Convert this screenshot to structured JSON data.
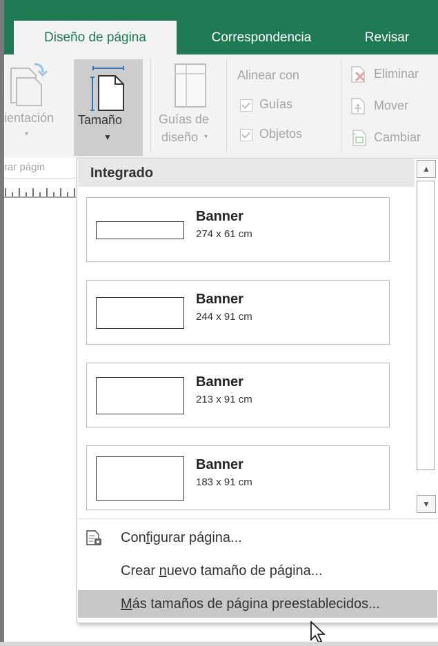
{
  "tabs": [
    {
      "label": "Diseño de página",
      "active": true
    },
    {
      "label": "Correspondencia",
      "active": false
    },
    {
      "label": "Revisar",
      "active": false
    }
  ],
  "ribbon": {
    "orientation_label": "ientación",
    "size_label": "Tamaño",
    "guides_line1": "Guías de",
    "guides_line2": "diseño",
    "align_title": "Alinear con",
    "align_guides": "Guías",
    "align_objects": "Objetos",
    "delete_label": "Eliminar",
    "move_label": "Mover",
    "change_label": "Cambiar",
    "group_label": "rar págin"
  },
  "dropdown": {
    "header": "Integrado",
    "items": [
      {
        "name": "Banner",
        "size": "274 x 61 cm"
      },
      {
        "name": "Banner",
        "size": "244 x 91 cm"
      },
      {
        "name": "Banner",
        "size": "213 x 91 cm"
      },
      {
        "name": "Banner",
        "size": "183 x 91 cm"
      }
    ],
    "menu": {
      "setup_pre": "Con",
      "setup_u": "f",
      "setup_post": "igurar página...",
      "create_pre": "Crear ",
      "create_u": "n",
      "create_post": "uevo tamaño de página...",
      "more_pre": "",
      "more_u": "M",
      "more_post": "ás tamaños de página preestablecidos..."
    }
  },
  "colors": {
    "accent": "#1d7a52",
    "hover": "#c8c8c8",
    "ribbon_bg": "#f3f3f3"
  }
}
